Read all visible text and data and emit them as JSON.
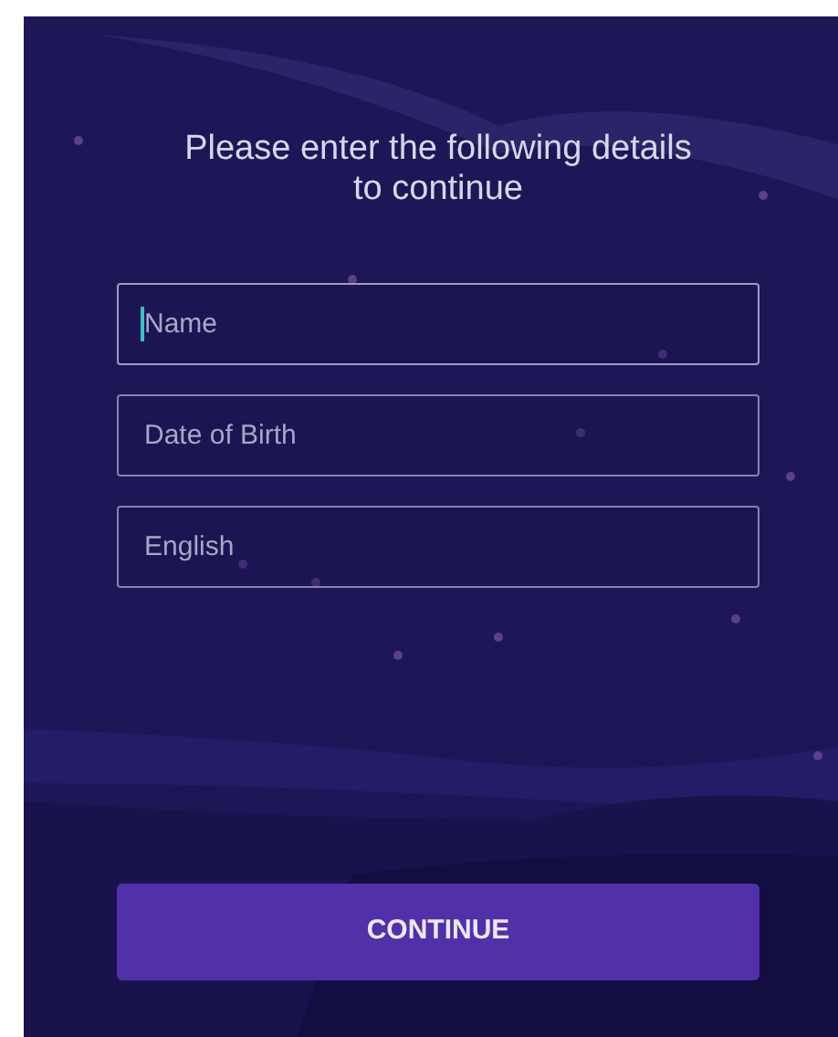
{
  "heading": "Please enter the following details to continue",
  "fields": [
    {
      "placeholder": "Name",
      "focused": true
    },
    {
      "placeholder": "Date of Birth",
      "focused": false
    },
    {
      "placeholder": "English",
      "focused": false
    }
  ],
  "continue_button": {
    "label": "CONTINUE"
  }
}
